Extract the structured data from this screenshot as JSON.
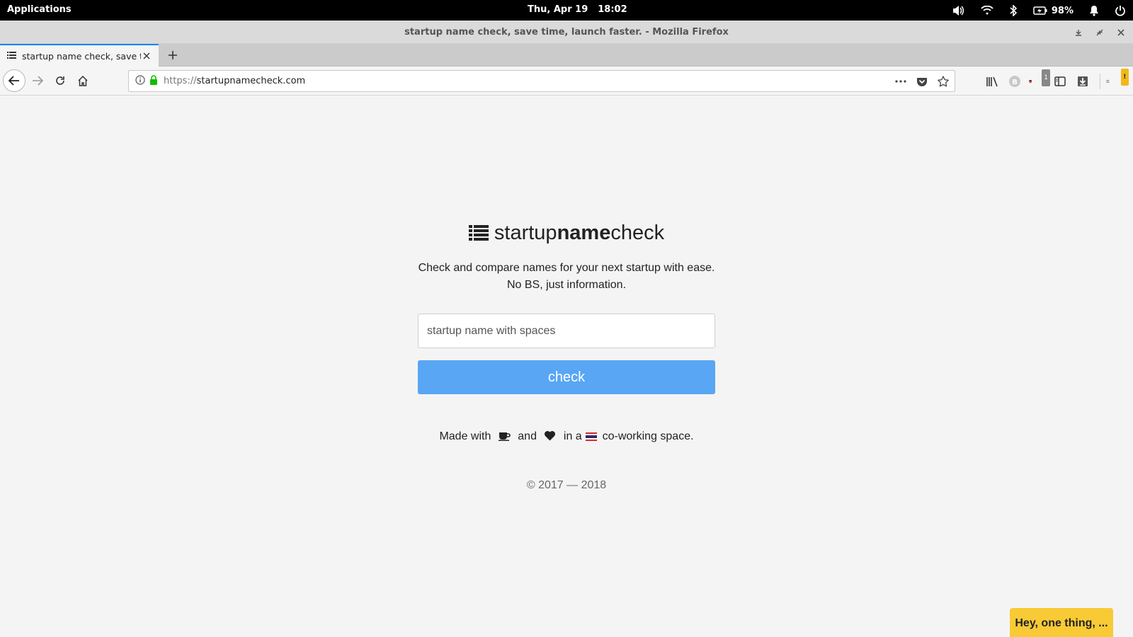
{
  "system_bar": {
    "applications_label": "Applications",
    "date": "Thu, Apr 19",
    "time": "18:02",
    "battery_percent": "98%"
  },
  "window": {
    "title": "startup name check, save time, launch faster. - Mozilla Firefox"
  },
  "tab": {
    "title": "startup name check, save time, launch faster."
  },
  "nav": {
    "url_scheme": "https://",
    "url_host": "startupnamecheck.com",
    "addon_badge": "1",
    "menu_badge": "!"
  },
  "page": {
    "brand": {
      "word1": "startup",
      "word2": "name",
      "word3": "check"
    },
    "tagline_line1": "Check and compare names for your next startup with ease.",
    "tagline_line2": "No BS, just information.",
    "input_placeholder": "startup name with spaces",
    "check_label": "check",
    "madewith": {
      "prefix": "Made with",
      "and": "and",
      "in_a": "in a",
      "suffix": "co-working space."
    },
    "copyright": "© 2017 — 2018",
    "hey_label": "Hey, one thing, ..."
  },
  "colors": {
    "accent_tab": "#0a84ff",
    "check_button": "#58a6f4",
    "hey_button": "#f8ca35"
  }
}
